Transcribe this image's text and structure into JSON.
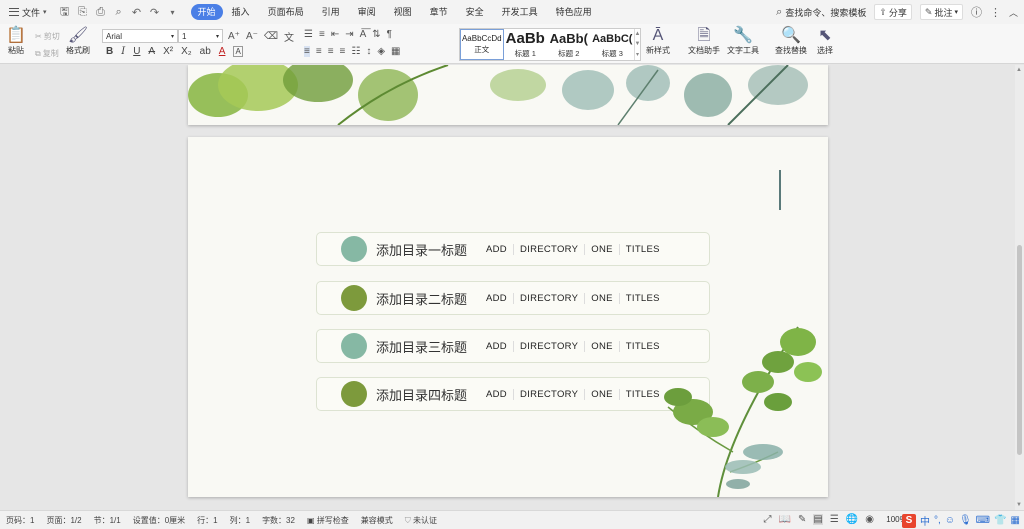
{
  "menubar": {
    "file_label": "文件",
    "tabs": [
      "开始",
      "插入",
      "页面布局",
      "引用",
      "审阅",
      "视图",
      "章节",
      "安全",
      "开发工具",
      "特色应用"
    ],
    "active_tab": "开始",
    "search_label": "查找命令、搜索模板",
    "share_label": "分享",
    "comment_label": "批注"
  },
  "ribbon": {
    "paste_label": "粘贴",
    "cut_label": "剪切",
    "copy_label": "复制",
    "format_painter_label": "格式刷",
    "font_name": "Arial",
    "font_size": "1",
    "styles": [
      {
        "preview": "AaBbCcDd",
        "name": "正文"
      },
      {
        "preview": "AaBb",
        "name": "标题 1"
      },
      {
        "preview": "AaBb(",
        "name": "标题 2"
      },
      {
        "preview": "AaBbC(",
        "name": "标题 3"
      }
    ],
    "new_style_label": "新样式",
    "doc_assistant_label": "文档助手",
    "text_tools_label": "文字工具",
    "find_replace_label": "查找替换",
    "select_label": "选择"
  },
  "toc": [
    {
      "cn": "添加目录一标题",
      "en": [
        "ADD",
        "DIRECTORY",
        "ONE",
        "TITLES"
      ],
      "color": "#86b8a4"
    },
    {
      "cn": "添加目录二标题",
      "en": [
        "ADD",
        "DIRECTORY",
        "ONE",
        "TITLES"
      ],
      "color": "#7d9a3c"
    },
    {
      "cn": "添加目录三标题",
      "en": [
        "ADD",
        "DIRECTORY",
        "ONE",
        "TITLES"
      ],
      "color": "#86b8a4"
    },
    {
      "cn": "添加目录四标题",
      "en": [
        "ADD",
        "DIRECTORY",
        "ONE",
        "TITLES"
      ],
      "color": "#7d9a3c"
    }
  ],
  "status": {
    "page_num": "页码：1",
    "pages": "页面：1/2",
    "section": "节：1/1",
    "setting": "设置值：0厘米",
    "row": "行：1",
    "col": "列：1",
    "words": "字数：32",
    "spell": "拼写检查",
    "compat": "兼容模式",
    "cert": "未认证",
    "zoom": "100%"
  },
  "ime": {
    "logo": "S",
    "lang": "中"
  }
}
